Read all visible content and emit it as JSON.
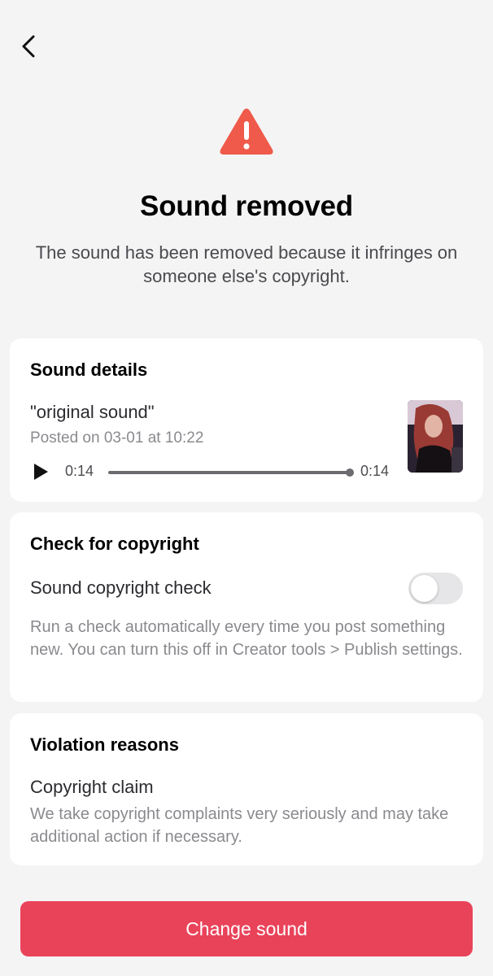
{
  "header": {
    "back_icon": "chevron-left-icon"
  },
  "alert": {
    "icon": "warning-triangle-icon",
    "icon_color": "#ef5a4a",
    "title": "Sound removed",
    "message": "The sound has been removed because it infringes on someone else's copyright."
  },
  "sound_details": {
    "heading": "Sound details",
    "sound_name": "\"original sound\"",
    "posted": "Posted on 03-01 at 10:22",
    "current_time": "0:14",
    "duration": "0:14",
    "progress": 1.0,
    "play_icon": "play-icon"
  },
  "copyright_check": {
    "heading": "Check for copyright",
    "toggle_label": "Sound copyright check",
    "toggle_on": false,
    "description": "Run a check automatically every time you post something new. You can turn this off in Creator tools > Publish settings."
  },
  "violation": {
    "heading": "Violation reasons",
    "claim_title": "Copyright claim",
    "claim_description": "We take copyright complaints very seriously and may take additional action if necessary."
  },
  "footer": {
    "button_label": "Change sound",
    "button_color": "#e9435a"
  }
}
